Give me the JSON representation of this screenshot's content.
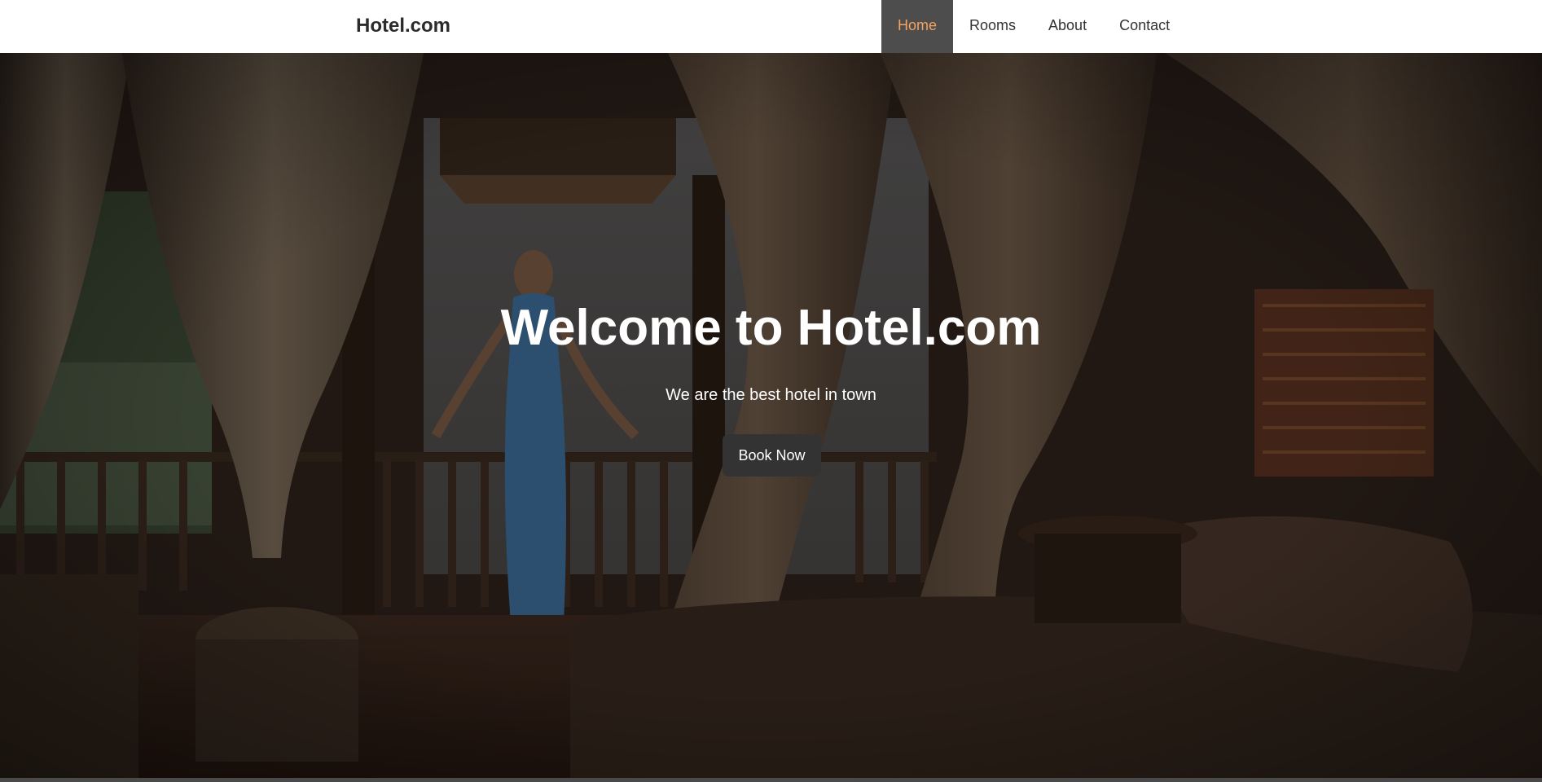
{
  "navbar": {
    "brand": "Hotel.com",
    "links": [
      {
        "label": "Home",
        "active": true
      },
      {
        "label": "Rooms",
        "active": false
      },
      {
        "label": "About",
        "active": false
      },
      {
        "label": "Contact",
        "active": false
      }
    ],
    "active_color": "#f4a261"
  },
  "hero": {
    "title": "Welcome to Hotel.com",
    "subtitle": "We are the best hotel in town",
    "cta_label": "Book Now"
  }
}
